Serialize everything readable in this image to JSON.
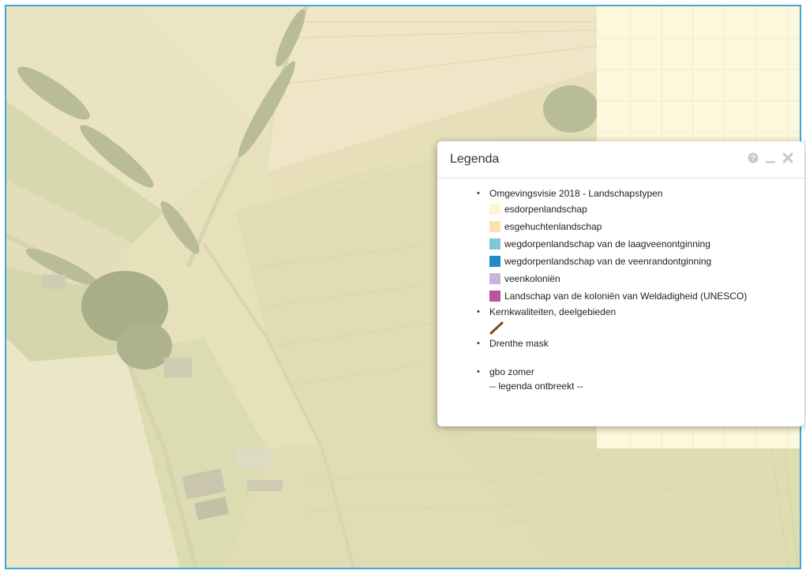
{
  "map": {
    "colors": {
      "field_light": "#eee7c4",
      "field_mid": "#e0ddb6",
      "field_green": "#cfd3a8",
      "tree_dark": "#a9b089",
      "road": "#d9d3b2",
      "unprocessed_area": "#fdf7dc",
      "frame_border": "#3aa9dd"
    }
  },
  "legend": {
    "title": "Legenda",
    "controls": {
      "help_icon": "question-circle-icon",
      "minimize_icon": "minimize-icon",
      "close_icon": "close-icon"
    },
    "layers": [
      {
        "name": "Omgevingsvisie 2018 - Landschapstypen",
        "classes": [
          {
            "label": "esdorpenlandschap",
            "color": "#fdf6d3"
          },
          {
            "label": "esgehuchtenlandschap",
            "color": "#fce3ae"
          },
          {
            "label": "wegdorpenlandschap van de laagveenontginning",
            "color": "#7fc7d6"
          },
          {
            "label": "wegdorpenlandschap van de veenrandontginning",
            "color": "#1f8ec4"
          },
          {
            "label": "veenkoloniën",
            "color": "#c7b4dc"
          },
          {
            "label": "Landschap van de koloniën van Weldadigheid (UNESCO)",
            "color": "#b5579a"
          }
        ]
      },
      {
        "name": "Kernkwaliteiten, deelgebieden",
        "symbol_color": "#7b4a16"
      },
      {
        "name": "Drenthe mask"
      },
      {
        "name": "gbo zomer",
        "note": "-- legenda ontbreekt --"
      }
    ]
  }
}
